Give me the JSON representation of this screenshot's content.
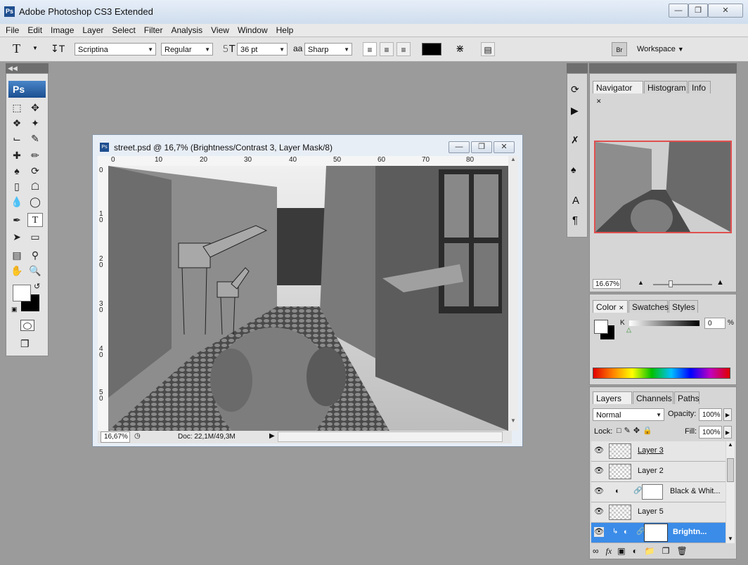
{
  "app": {
    "title": "Adobe Photoshop CS3 Extended",
    "logo_text": "Ps"
  },
  "menu": [
    "File",
    "Edit",
    "Image",
    "Layer",
    "Select",
    "Filter",
    "Analysis",
    "View",
    "Window",
    "Help"
  ],
  "options": {
    "tool_glyph": "T",
    "font_family": "Scriptina",
    "font_style": "Regular",
    "font_size": "36 pt",
    "aa_label": "aa",
    "antialias": "Sharp",
    "workspace": "Workspace"
  },
  "tools_logo": "Ps",
  "document": {
    "title": "street.psd @ 16,7% (Brightness/Contrast 3, Layer Mask/8)",
    "zoom": "16,67%",
    "doc_size": "Doc: 22,1M/49,3M",
    "ruler_h": [
      "0",
      "10",
      "20",
      "30",
      "40",
      "50",
      "60",
      "70",
      "80"
    ],
    "ruler_v": [
      "0",
      "1\n0",
      "2\n0",
      "3\n0",
      "4\n0",
      "5\n0"
    ]
  },
  "navigator": {
    "tabs": [
      "Navigator",
      "Histogram",
      "Info"
    ],
    "zoom": "16.67%"
  },
  "color": {
    "tabs": [
      "Color",
      "Swatches",
      "Styles"
    ],
    "channel": "K",
    "value": "0",
    "unit": "%"
  },
  "layers": {
    "tabs": [
      "Layers",
      "Channels",
      "Paths"
    ],
    "blend_mode": "Normal",
    "opacity_label": "Opacity:",
    "opacity": "100%",
    "lock_label": "Lock:",
    "fill_label": "Fill:",
    "fill": "100%",
    "items": [
      {
        "name": "Layer 3"
      },
      {
        "name": "Layer 2"
      },
      {
        "name": "Black & Whit..."
      },
      {
        "name": "Layer 5"
      },
      {
        "name": "Brightn..."
      }
    ]
  }
}
